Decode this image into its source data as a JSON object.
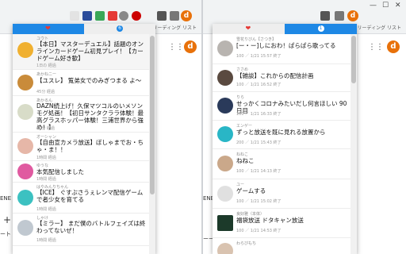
{
  "left_window": {
    "bookmarks_label": "リーディング リスト",
    "profile_initial": "d",
    "grid_icon": "apps-grid-icon",
    "side_fragments": [
      "ENE",
      "+",
      "ート"
    ],
    "popup": {
      "tabs": [
        {
          "icon": "heart-icon"
        },
        {
          "badge": "6"
        }
      ],
      "items": [
        {
          "channel": "ユウト",
          "title": "【本日】マスターデュエル】話題のオンラインカードゲーム初見プレイ！【カードゲーム好き歓】",
          "stat": "1日の 経過"
        },
        {
          "channel": "あかねニー",
          "title": "【ユスレ】 覧弟女でのみぎつまる よ～",
          "stat": "45分 経過"
        },
        {
          "channel": "あかるん",
          "title": "DAZN続上げ！久保マツコルのいメソンモグ処画！【初日サンタクララ体験！最高グラスホッパー体験！三浦世界から強め！】",
          "stat": "20分 経過"
        },
        {
          "channel": "オーシャン",
          "title": "【自由宣カメラ放送】ぼしゃまでお・ちゃ・ま！！",
          "stat": "1時間 経過"
        },
        {
          "channel": "ゆうな",
          "title": "本気配信しました",
          "stat": "1時間 経過"
        },
        {
          "channel": "はやみんりちゃん",
          "title": "【ICE】 ぐすぶさうぇレンマ配信ゲームで者少女を育てる",
          "stat": "1時間 経過"
        },
        {
          "channel": "しゃけ",
          "title": "【ミラー】 まだ僕のバトルフェイズは終わってないぜ！",
          "stat": "1時間 経過"
        }
      ]
    }
  },
  "right_window": {
    "bookmarks_label": "リーディング リスト",
    "profile_initial": "d",
    "side_fragments": [
      "ENE",
      "ーート"
    ],
    "popup": {
      "tabs": [
        {
          "icon": "heart-icon"
        },
        {
          "badge": "1"
        }
      ],
      "items": [
        {
          "channel": "雪花りびん【さつき】",
          "title": "[ー・ー]しにおわ！ぱらぱら歌ってる",
          "stat": "100 ／ 1/21 15:57 終了"
        },
        {
          "channel": "ささめ",
          "title": "【雑談】これからの配信計画",
          "stat": "100 ／ 1/21 16:52 終了"
        },
        {
          "channel": "りら",
          "title": "せっかくコロナみたいだし何言ほしい 90日目",
          "stat": "100 ／ 1/21 16:33 終了"
        },
        {
          "channel": "エンゲー",
          "title": "ずっと放送を既に見れる放置から",
          "stat": "200 ／ 1/21 15:43 終了"
        },
        {
          "channel": "ねねこ",
          "title": "ねねこ",
          "stat": "100 ／ 1/21 14:13 終了"
        },
        {
          "channel": "ユー",
          "title": "ゲームする",
          "stat": "100 ／ 1/21 15:02 終了"
        },
        {
          "channel": "良好雅（本体）",
          "title": "福袋放送 ドタキャン放送",
          "stat": "100 ／ 1/21 14:53 終了"
        },
        {
          "channel": "わらびもち",
          "title": "",
          "stat": ""
        }
      ]
    }
  },
  "colors": {
    "tab_active": "#1e88e5",
    "heart": "#e53935",
    "avatar": "#e8710a"
  }
}
